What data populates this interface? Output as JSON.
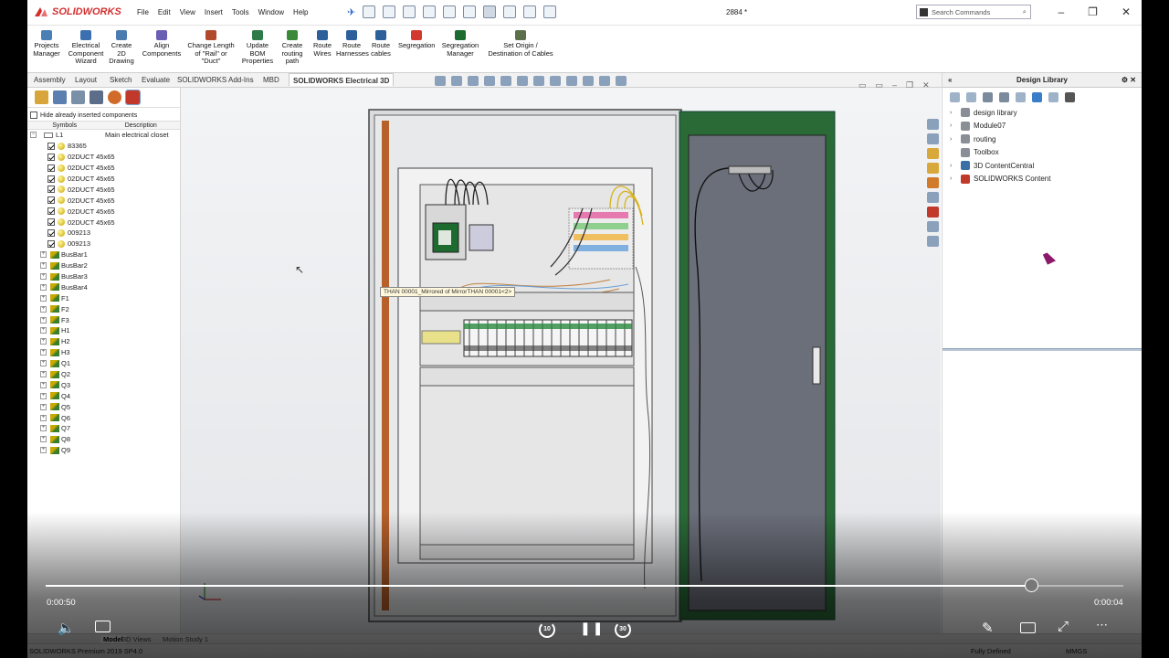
{
  "app": {
    "brand": "SOLIDWORKS",
    "doc_title": "2884 *",
    "search_placeholder": "Search Commands"
  },
  "menu": [
    "File",
    "Edit",
    "View",
    "Insert",
    "Tools",
    "Window",
    "Help"
  ],
  "ribbon": [
    {
      "label": "Projects\nManager",
      "color": "#4a7fb5"
    },
    {
      "label": "Electrical\nComponent\nWizard",
      "color": "#3b6fb0"
    },
    {
      "label": "Create\n2D\nDrawing",
      "color": "#4c7bb0"
    },
    {
      "label": "Align\nComponents",
      "color": "#6a5fb3"
    },
    {
      "label": "Change Length\nof \"Rail\" or\n\"Duct\"",
      "color": "#b04a2a"
    },
    {
      "label": "Update\nBOM\nProperties",
      "color": "#2f7a4a"
    },
    {
      "label": "Create\nrouting\npath",
      "color": "#3a8a3a"
    },
    {
      "label": "Route\nWires",
      "color": "#2d5f9a"
    },
    {
      "label": "Route\nHarnesses",
      "color": "#2d5f9a"
    },
    {
      "label": "Route\ncables",
      "color": "#2d5f9a"
    },
    {
      "label": "Segregation",
      "color": "#d33a2f"
    },
    {
      "label": "Segregation\nManager",
      "color": "#1d6b2f"
    },
    {
      "label": "Set Origin /\nDestination of Cables",
      "color": "#5a6f4a"
    }
  ],
  "tabs": [
    "Assembly",
    "Layout",
    "Sketch",
    "Evaluate",
    "SOLIDWORKS Add-Ins",
    "MBD",
    "SOLIDWORKS Electrical 3D"
  ],
  "feature_manager": {
    "hide_label": "Hide already inserted components",
    "col_symbols": "Symbols",
    "col_description": "Description",
    "root": {
      "name": "L1",
      "description": "Main electrical closet"
    },
    "items": [
      "83365",
      "02DUCT 45x65",
      "02DUCT 45x65",
      "02DUCT 45x65",
      "02DUCT 45x65",
      "02DUCT 45x65",
      "02DUCT 45x65",
      "02DUCT 45x65",
      "009213",
      "009213"
    ],
    "groups": [
      "BusBar1",
      "BusBar2",
      "BusBar3",
      "BusBar4",
      "F1",
      "F2",
      "F3",
      "H1",
      "H2",
      "H3",
      "Q1",
      "Q2",
      "Q3",
      "Q4",
      "Q5",
      "Q6",
      "Q7",
      "Q8",
      "Q9"
    ]
  },
  "viewport": {
    "tooltip": "THAN 00001_Mirrored of MirrorTHAN 00001<2>"
  },
  "design_library": {
    "title": "Design Library",
    "items": [
      {
        "label": "design library",
        "chevron": true
      },
      {
        "label": "Module07",
        "chevron": true
      },
      {
        "label": "routing",
        "chevron": true
      },
      {
        "label": "Toolbox",
        "chevron": false
      },
      {
        "label": "3D ContentCentral",
        "chevron": true
      },
      {
        "label": "SOLIDWORKS Content",
        "chevron": true
      }
    ]
  },
  "bottom_tabs": [
    "Model",
    "3D Views",
    "Motion Study 1"
  ],
  "status": {
    "left": "SOLIDWORKS Premium 2019 SP4.0",
    "state": "Fully Defined",
    "units": "MMGS"
  },
  "player": {
    "current": "0:00:50",
    "total": "0:00:04",
    "progress": 0.914,
    "skip_back": "10",
    "skip_fwd": "30"
  }
}
